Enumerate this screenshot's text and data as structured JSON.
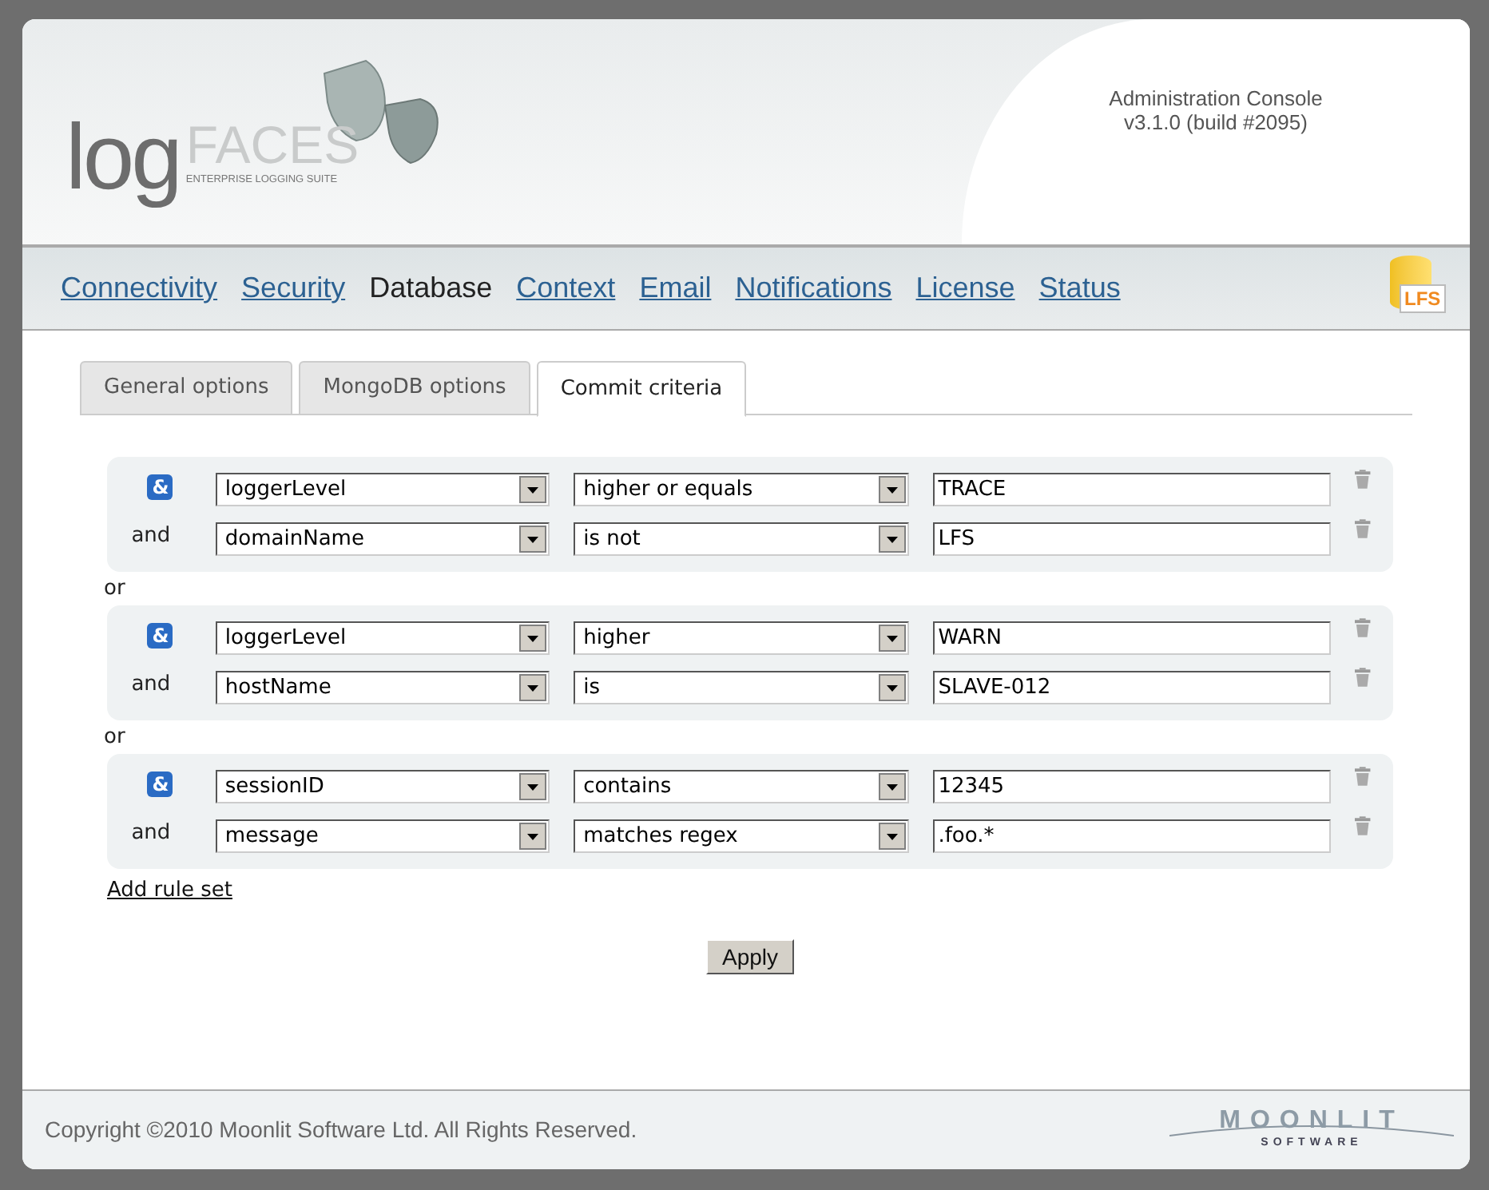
{
  "header": {
    "logo": {
      "part1": "log",
      "part2": "FACES",
      "tagline": "ENTERPRISE LOGGING SUITE"
    },
    "console_title": "Administration Console",
    "version": "v3.1.0 (build #2095)",
    "badge": "LFS"
  },
  "nav": [
    {
      "label": "Connectivity",
      "selected": false
    },
    {
      "label": "Security",
      "selected": false
    },
    {
      "label": "Database",
      "selected": true
    },
    {
      "label": "Context",
      "selected": false
    },
    {
      "label": "Email",
      "selected": false
    },
    {
      "label": "Notifications",
      "selected": false
    },
    {
      "label": "License",
      "selected": false
    },
    {
      "label": "Status",
      "selected": false
    }
  ],
  "tabs": [
    {
      "label": "General options",
      "selected": false
    },
    {
      "label": "MongoDB options",
      "selected": false
    },
    {
      "label": "Commit criteria",
      "selected": true
    }
  ],
  "rule_sets": [
    {
      "rules": [
        {
          "kind": "first",
          "label": "&",
          "field": "loggerLevel",
          "operator": "higher or equals",
          "value": "TRACE"
        },
        {
          "kind": "and",
          "label": "and",
          "field": "domainName",
          "operator": "is not",
          "value": "LFS"
        }
      ]
    },
    {
      "joiner": "or",
      "rules": [
        {
          "kind": "first",
          "label": "&",
          "field": "loggerLevel",
          "operator": "higher",
          "value": "WARN"
        },
        {
          "kind": "and",
          "label": "and",
          "field": "hostName",
          "operator": "is",
          "value": "SLAVE-012"
        }
      ]
    },
    {
      "joiner": "or",
      "rules": [
        {
          "kind": "first",
          "label": "&",
          "field": "sessionID",
          "operator": "contains",
          "value": "12345"
        },
        {
          "kind": "and",
          "label": "and",
          "field": "message",
          "operator": "matches regex",
          "value": ".foo.*"
        }
      ]
    }
  ],
  "add_link": "Add rule set",
  "apply_button": "Apply",
  "footer": {
    "copyright": "Copyright ©2010 Moonlit Software Ltd. All Rights Reserved.",
    "brand": "MOONLIT",
    "brand_sub": "SOFTWARE"
  }
}
